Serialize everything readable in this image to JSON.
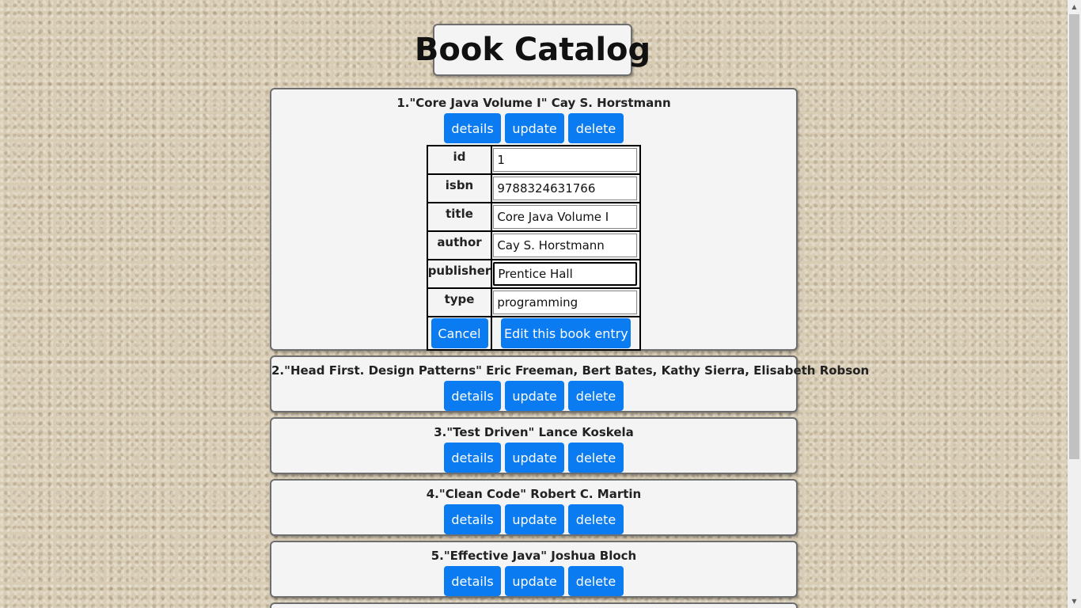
{
  "page": {
    "title": "Book Catalog"
  },
  "buttons": {
    "details": "details",
    "update": "update",
    "delete": "delete",
    "cancel": "Cancel",
    "edit": "Edit this book entry"
  },
  "books": [
    {
      "heading": "1.\"Core Java Volume I\" Cay S. Horstmann"
    },
    {
      "heading": "2.\"Head First. Design Patterns\" Eric Freeman, Bert Bates, Kathy Sierra, Elisabeth Robson"
    },
    {
      "heading": "3.\"Test Driven\" Lance Koskela"
    },
    {
      "heading": "4.\"Clean Code\" Robert C. Martin"
    },
    {
      "heading": "5.\"Effective Java\" Joshua Bloch"
    }
  ],
  "edit_form": {
    "fields": [
      {
        "label": "id",
        "value": "1"
      },
      {
        "label": "isbn",
        "value": "9788324631766"
      },
      {
        "label": "title",
        "value": "Core Java Volume I"
      },
      {
        "label": "author",
        "value": "Cay S. Horstmann"
      },
      {
        "label": "publisher",
        "value": "Prentice Hall"
      },
      {
        "label": "type",
        "value": "programming"
      }
    ]
  },
  "icons": {
    "scroll_up": "scroll-up-arrow-icon",
    "scroll_down": "scroll-down-arrow-icon"
  }
}
